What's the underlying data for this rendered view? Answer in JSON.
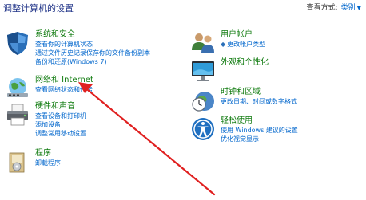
{
  "header": {
    "title": "调整计算机的设置",
    "view_by_label": "查看方式:",
    "view_by_value": "类别"
  },
  "categories": {
    "security": {
      "title": "系统和安全",
      "links": [
        "查看你的计算机状态",
        "通过文件历史记录保存你的文件备份副本",
        "备份和还原(Windows 7)"
      ]
    },
    "network": {
      "title": "网络和 Internet",
      "links": [
        "查看网络状态和任务"
      ]
    },
    "hardware": {
      "title": "硬件和声音",
      "links": [
        "查看设备和打印机",
        "添加设备",
        "调整常用移动设置"
      ]
    },
    "programs": {
      "title": "程序",
      "links": [
        "卸载程序"
      ]
    },
    "accounts": {
      "title": "用户帐户",
      "links": [
        "更改帐户类型"
      ]
    },
    "appearance": {
      "title": "外观和个性化",
      "links": []
    },
    "clock": {
      "title": "时钟和区域",
      "links": [
        "更改日期、时间或数字格式"
      ]
    },
    "ease": {
      "title": "轻松使用",
      "links": [
        "使用 Windows 建议的设置",
        "优化视觉显示"
      ]
    }
  },
  "colors": {
    "title_blue": "#1e3287",
    "category_green": "#0e7a0d",
    "link_blue": "#0066cc",
    "annotation_red": "#e02020"
  },
  "icons": {
    "security": "shield-icon",
    "network": "globe-network-icon",
    "hardware": "printer-icon",
    "programs": "programs-disc-icon",
    "accounts": "users-icon",
    "appearance": "monitor-icon",
    "clock": "clock-globe-icon",
    "ease": "accessibility-icon"
  }
}
